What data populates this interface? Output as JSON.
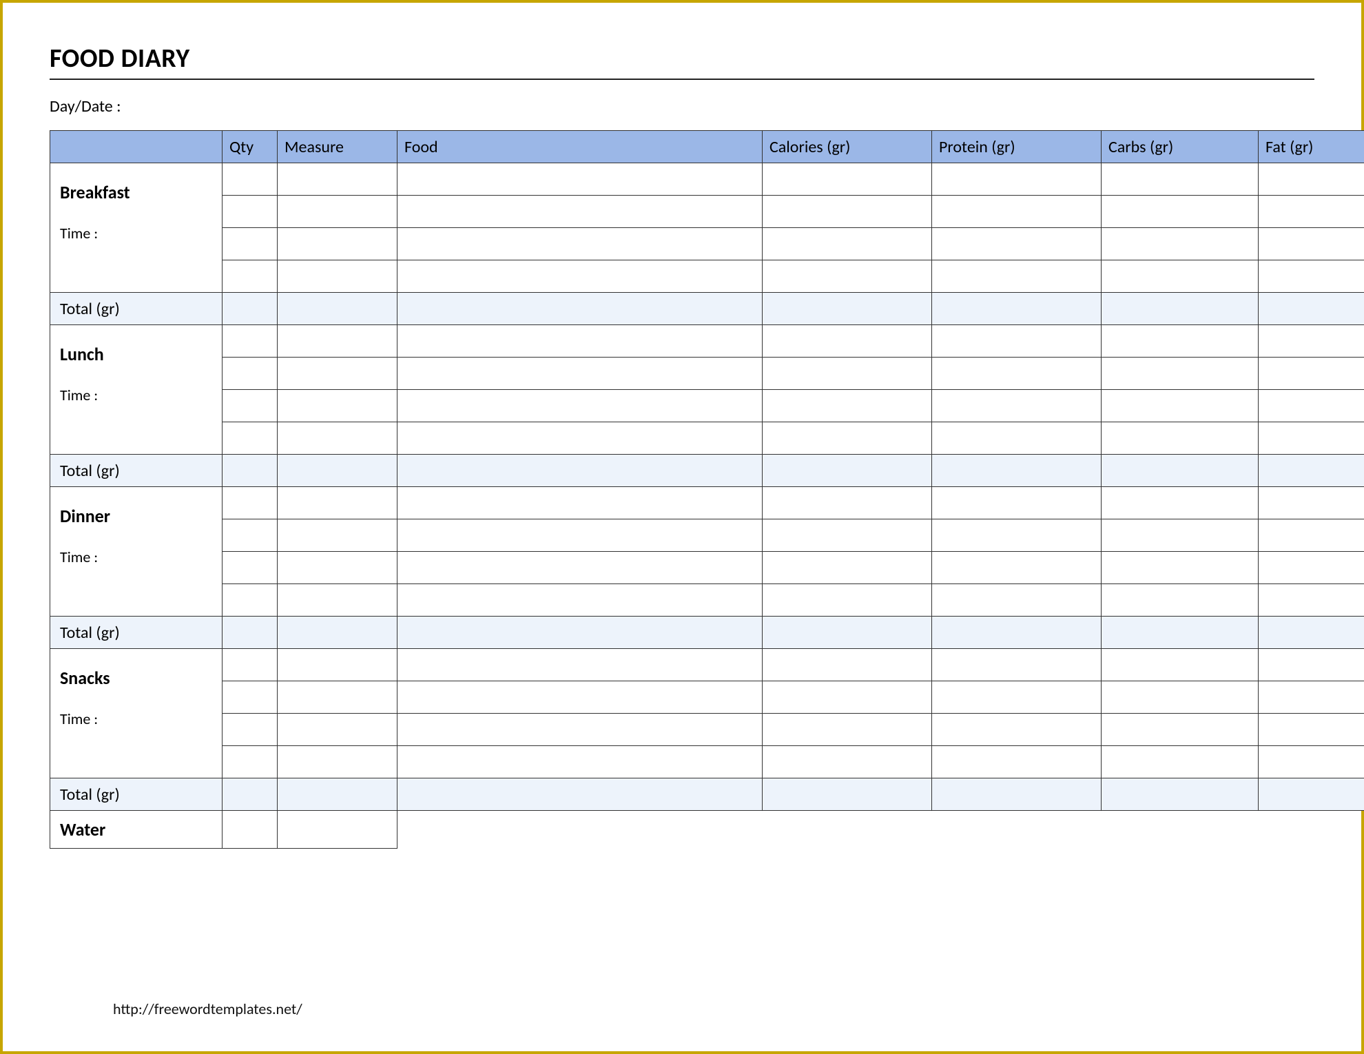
{
  "title": "FOOD DIARY",
  "daydate_label": "Day/Date :",
  "columns": {
    "qty": "Qty",
    "measure": "Measure",
    "food": "Food",
    "calories": "Calories (gr)",
    "protein": "Protein (gr)",
    "carbs": "Carbs (gr)",
    "fat": "Fat (gr)"
  },
  "meals": {
    "breakfast": {
      "name": "Breakfast",
      "time_label": "Time :",
      "total_label": "Total (gr)"
    },
    "lunch": {
      "name": "Lunch",
      "time_label": "Time :",
      "total_label": "Total (gr)"
    },
    "dinner": {
      "name": "Dinner",
      "time_label": "Time :",
      "total_label": "Total (gr)"
    },
    "snacks": {
      "name": "Snacks",
      "time_label": "Time :",
      "total_label": "Total (gr)"
    }
  },
  "water_label": "Water",
  "footer_url": "http://freewordtemplates.net/"
}
